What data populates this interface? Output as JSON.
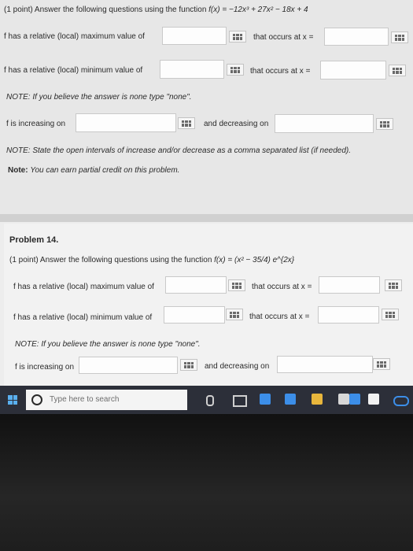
{
  "top_problem": {
    "intro_prefix": "(1 point) Answer the following questions using the function ",
    "function": "f(x) = −12x³ + 27x² − 18x + 4",
    "max_label": "f has a relative (local) maximum value of",
    "max_value": "",
    "max_at_label": "that occurs at x =",
    "max_at_value": "",
    "min_label": "f has a relative (local) minimum value of",
    "min_value": "",
    "min_at_label": "that occurs at x =",
    "min_at_value": "",
    "note1": "NOTE: If you believe the answer is none type \"none\".",
    "increasing_label": "f is increasing on",
    "increasing_value": "",
    "decreasing_label": "and decreasing on",
    "decreasing_value": "",
    "note2": "NOTE: State the open intervals of increase and/or decrease as a comma separated list (if needed).",
    "note3_bold": "Note:",
    "note3_rest": "You can earn partial credit on this problem."
  },
  "problem14": {
    "title": "Problem 14.",
    "intro_prefix": "(1 point) Answer the following questions using the function ",
    "function": "f(x) = (x² − 35/4) e^{2x}",
    "max_label": "f has a relative (local) maximum value of",
    "max_value": "",
    "max_at_label": "that occurs at x =",
    "max_at_value": "",
    "min_label": "f has a relative (local) minimum value of",
    "min_value": "",
    "min_at_label": "that occurs at x =",
    "min_at_value": "",
    "note1": "NOTE: If you believe the answer is none type \"none\".",
    "increasing_label": "f is increasing on",
    "decreasing_label": "and decreasing on"
  },
  "taskbar": {
    "search_placeholder": "Type here to search",
    "icons": [
      "windows-logo-icon",
      "cortana-circle-icon",
      "mic-icon",
      "task-view-icon",
      "mail-icon",
      "store-icon",
      "app-icon",
      "amazon-icon",
      "link-icon"
    ]
  },
  "colors": {
    "accent": "#3c8ee8",
    "taskbar": "#2c2f39",
    "page": "#ededed"
  }
}
